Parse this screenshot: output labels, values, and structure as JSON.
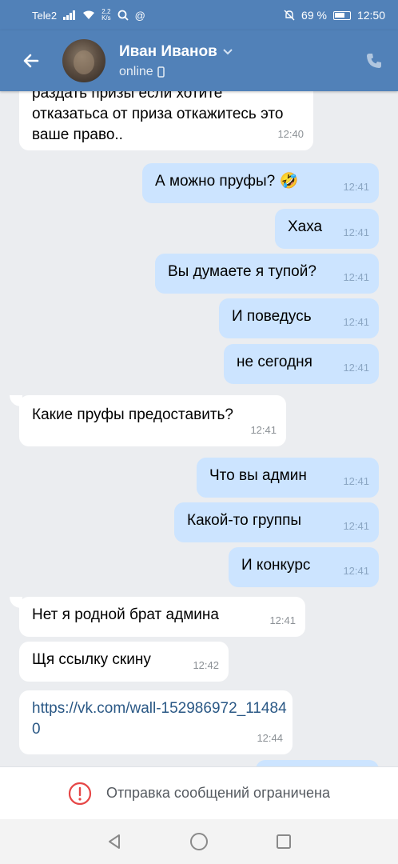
{
  "status_bar": {
    "carrier": "Tele2",
    "speed_value": "2,2",
    "speed_unit": "K/s",
    "battery": "69 %",
    "time": "12:50"
  },
  "header": {
    "contact_name": "Иван Иванов",
    "contact_status": "online",
    "accent_color": "#5181b8"
  },
  "messages": [
    {
      "dir": "in",
      "text": "раздать призы если хотите",
      "time": "",
      "partial": true
    },
    {
      "dir": "in",
      "text": "отказатьса от приза откажитесь это ваше право..",
      "time": "12:40"
    },
    {
      "dir": "out",
      "text": "А можно пруфы? 🤣",
      "time": "12:41"
    },
    {
      "dir": "out",
      "text": "Хаха",
      "time": "12:41"
    },
    {
      "dir": "out",
      "text": "Вы думаете я тупой?",
      "time": "12:41"
    },
    {
      "dir": "out",
      "text": "И поведусь",
      "time": "12:41"
    },
    {
      "dir": "out",
      "text": "не сегодня",
      "time": "12:41"
    },
    {
      "dir": "in",
      "text": "Какие пруфы предоставить?",
      "time": "12:41"
    },
    {
      "dir": "out",
      "text": "Что вы админ",
      "time": "12:41"
    },
    {
      "dir": "out",
      "text": "Какой-то группы",
      "time": "12:41"
    },
    {
      "dir": "out",
      "text": "И конкурс",
      "time": "12:41"
    },
    {
      "dir": "in",
      "text": "Нет я родной брат админа",
      "time": "12:41"
    },
    {
      "dir": "in",
      "text": "Щя ссылку скину",
      "time": "12:42"
    },
    {
      "dir": "in",
      "text": "https://vk.com/wall-152986972_114840",
      "time": "12:44",
      "link": true
    }
  ],
  "restriction": {
    "text": "Отправка сообщений ограничена",
    "color": "#e64646"
  },
  "nav": {
    "back": "back-triangle-icon",
    "home": "home-circle-icon",
    "recents": "recents-square-icon"
  }
}
